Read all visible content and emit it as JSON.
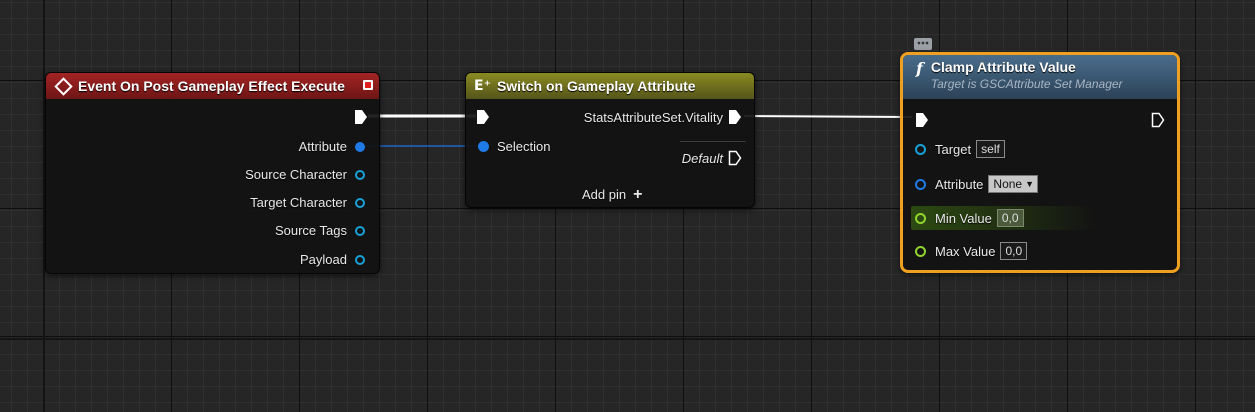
{
  "event_node": {
    "title": "Event On Post Gameplay Effect Execute",
    "pins": [
      {
        "label": "Attribute",
        "kind": "filled"
      },
      {
        "label": "Source Character",
        "kind": "hollow"
      },
      {
        "label": "Target Character",
        "kind": "hollow"
      },
      {
        "label": "Source Tags",
        "kind": "hollow"
      },
      {
        "label": "Payload",
        "kind": "hollow"
      }
    ]
  },
  "switch_node": {
    "title": "Switch on Gameplay Attribute",
    "output_case": "StatsAttributeSet.Vitality",
    "selection_label": "Selection",
    "default_label": "Default",
    "add_pin_label": "Add pin"
  },
  "clamp_node": {
    "title": "Clamp Attribute Value",
    "subtitle": "Target is GSCAttribute Set Manager",
    "target_label": "Target",
    "target_value": "self",
    "attribute_label": "Attribute",
    "attribute_value": "None",
    "min_label": "Min Value",
    "min_value": "0,0",
    "max_label": "Max Value",
    "max_value": "0,0"
  },
  "colors": {
    "event_header": "#8a1c1c",
    "switch_header": "#6b6b1a",
    "clamp_header": "#3d5a74",
    "selection_border": "#f0a020",
    "object_pin": "#17a1d6",
    "float_pin": "#8fd42e"
  }
}
